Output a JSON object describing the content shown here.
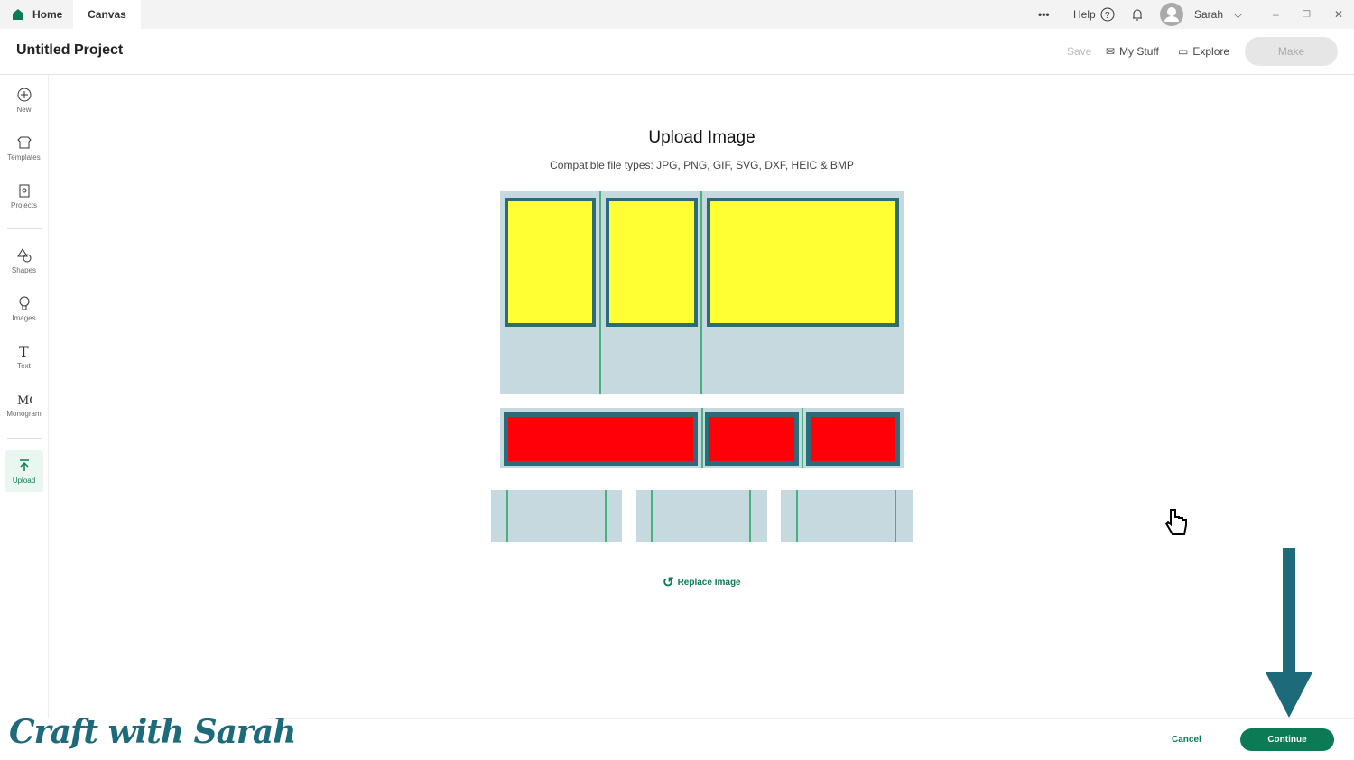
{
  "tabs": {
    "home": "Home",
    "canvas": "Canvas"
  },
  "titlebar": {
    "more": "•••",
    "help": "Help",
    "user": "Sarah",
    "minimize": "–",
    "restore": "❐",
    "close": "✕"
  },
  "header": {
    "title": "Untitled Project",
    "save": "Save",
    "my_stuff": "My Stuff",
    "explore": "Explore",
    "make": "Make"
  },
  "sidebar": {
    "items": [
      {
        "label": "New"
      },
      {
        "label": "Templates"
      },
      {
        "label": "Projects"
      },
      {
        "label": "Shapes"
      },
      {
        "label": "Images"
      },
      {
        "label": "Text"
      },
      {
        "label": "Monogram"
      },
      {
        "label": "Upload"
      }
    ]
  },
  "main": {
    "title": "Upload Image",
    "subtitle": "Compatible file types:  JPG, PNG, GIF, SVG, DXF, HEIC & BMP",
    "replace": "Replace Image"
  },
  "footer": {
    "cancel": "Cancel",
    "continue": "Continue"
  },
  "watermark": "Craft with Sarah",
  "colors": {
    "accent": "#0b7a55",
    "arrow": "#1d6a7a",
    "yellow": "#ffff33",
    "red": "#ff0008"
  }
}
